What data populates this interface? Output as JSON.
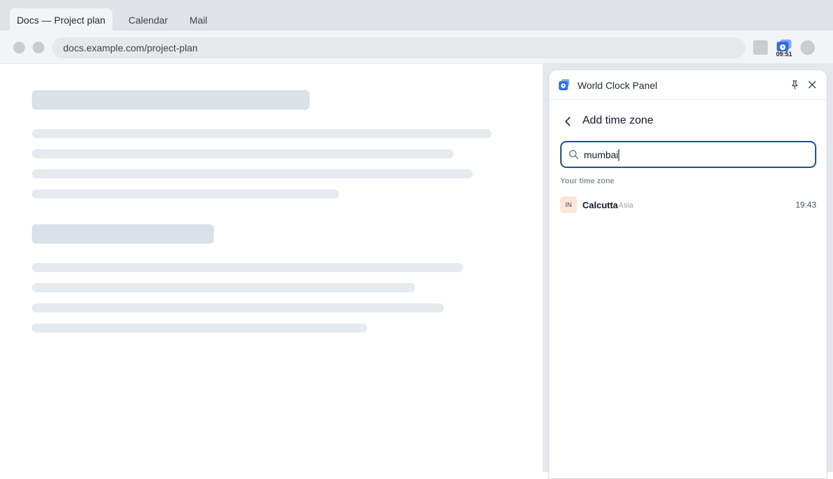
{
  "browser": {
    "tabs": [
      {
        "label": "Docs — Project plan",
        "active": true
      },
      {
        "label": "Calendar",
        "active": false
      },
      {
        "label": "Mail",
        "active": false
      }
    ],
    "url": "docs.example.com/project-plan",
    "extension_badge": "09:51"
  },
  "panel": {
    "title": "World Clock Panel",
    "subtitle": "Add time zone",
    "search": {
      "value": "mumbai",
      "placeholder": ""
    },
    "section_label": "Your time zone",
    "results": [
      {
        "country_code": "IN",
        "city": "Calcutta",
        "region": "Asia",
        "time": "19:43"
      }
    ]
  },
  "colors": {
    "accent": "#1e4f8f",
    "brand_icon": "#2f6fe0",
    "tab_bar": "#dfe3e8",
    "skeleton": "#e6e9ee"
  },
  "icons": {
    "back": "chevron-left-icon",
    "search": "search-icon",
    "pin": "pin-icon",
    "close": "close-icon",
    "app": "world-clock-icon"
  }
}
